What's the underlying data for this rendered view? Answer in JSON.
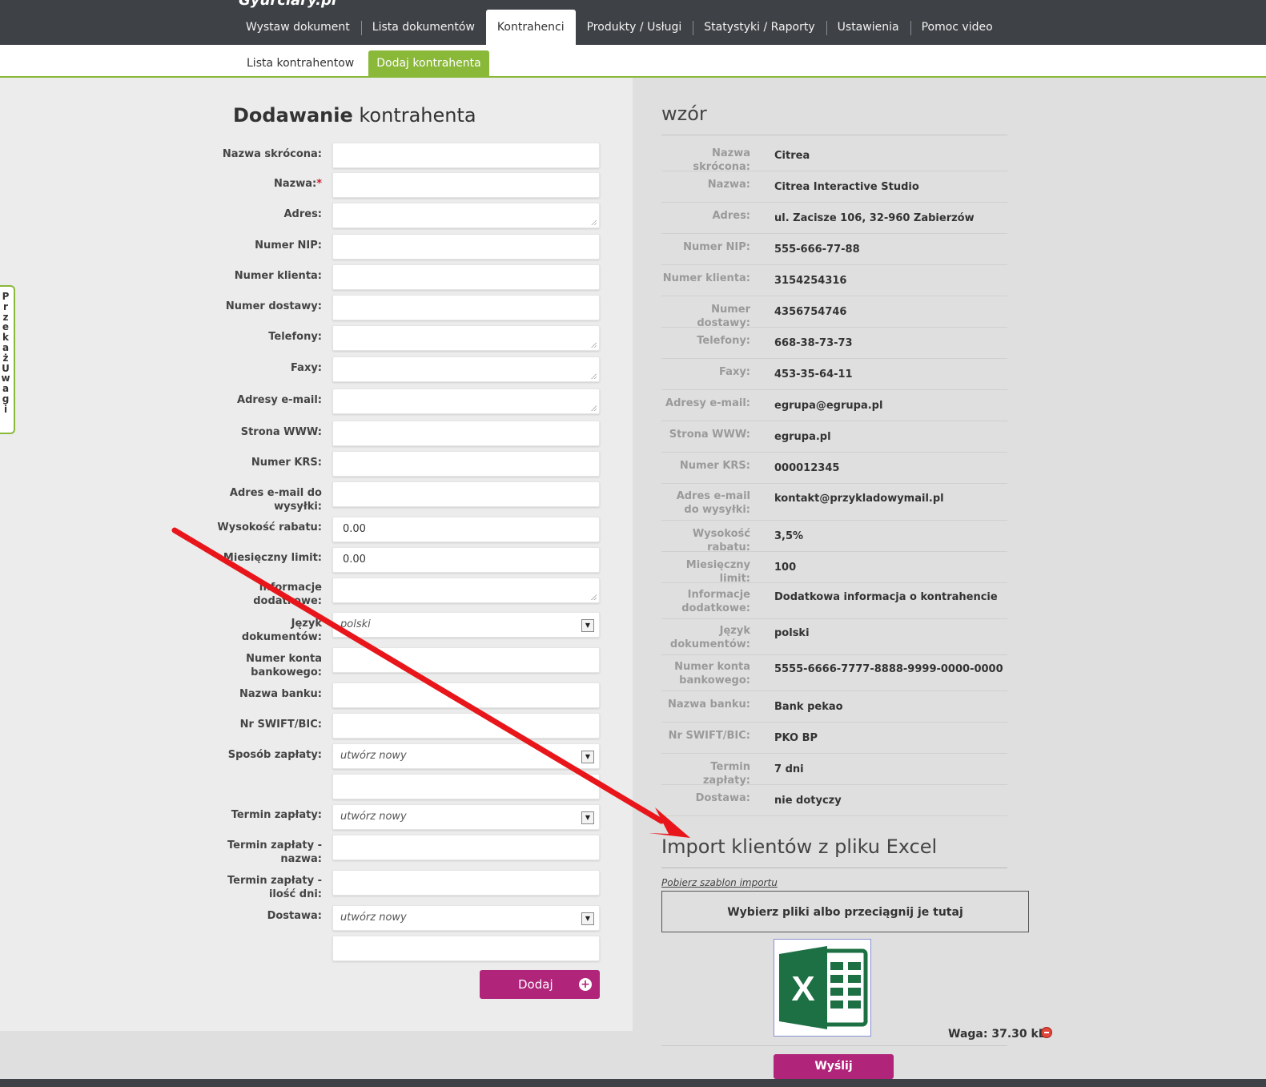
{
  "topbar": {
    "logo_fragment": "Gyurciary.pl",
    "nav": [
      "Wystaw dokument",
      "Lista dokumentów",
      "Kontrahenci",
      "Produkty / Usługi",
      "Statystyki / Raporty",
      "Ustawienia",
      "Pomoc video"
    ],
    "active_index": 2
  },
  "subnav": {
    "items": [
      "Lista kontrahentow",
      "Dodaj kontrahenta"
    ],
    "active_index": 1
  },
  "feedback_tab": "Przekaż Uwagi",
  "form": {
    "title_bold": "Dodawanie",
    "title_rest": " kontrahenta",
    "fields": {
      "nazwa_skrocona": {
        "label": "Nazwa skrócona:",
        "value": ""
      },
      "nazwa": {
        "label": "Nazwa:",
        "required": "*",
        "value": ""
      },
      "adres": {
        "label": "Adres:",
        "value": ""
      },
      "numer_nip": {
        "label": "Numer NIP:",
        "value": ""
      },
      "numer_klienta": {
        "label": "Numer klienta:",
        "value": ""
      },
      "numer_dostawy": {
        "label": "Numer dostawy:",
        "value": ""
      },
      "telefony": {
        "label": "Telefony:",
        "value": ""
      },
      "faxy": {
        "label": "Faxy:",
        "value": ""
      },
      "adresy_email": {
        "label": "Adresy e-mail:",
        "value": ""
      },
      "strona_www": {
        "label": "Strona WWW:",
        "value": ""
      },
      "numer_krs": {
        "label": "Numer KRS:",
        "value": ""
      },
      "email_wysylki": {
        "label": "Adres e-mail do wysyłki:",
        "value": ""
      },
      "rabat": {
        "label": "Wysokość rabatu:",
        "value": "0.00"
      },
      "limit": {
        "label": "Miesięczny limit:",
        "value": "0.00"
      },
      "informacje": {
        "label": "Informacje dodatkowe:",
        "value": ""
      },
      "jezyk": {
        "label": "Język dokumentów:",
        "value": "polski"
      },
      "konto": {
        "label": "Numer konta bankowego:",
        "value": ""
      },
      "bank": {
        "label": "Nazwa banku:",
        "value": ""
      },
      "swift": {
        "label": "Nr SWIFT/BIC:",
        "value": ""
      },
      "sposob_zaplaty": {
        "label": "Sposób zapłaty:",
        "value": "utwórz nowy",
        "extra_value": ""
      },
      "termin_zaplaty": {
        "label": "Termin zapłaty:",
        "value": "utwórz nowy"
      },
      "termin_nazwa": {
        "label": "Termin zapłaty - nazwa:",
        "value": ""
      },
      "termin_dni": {
        "label": "Termin zapłaty - ilość dni:",
        "value": ""
      },
      "dostawa": {
        "label": "Dostawa:",
        "value": "utwórz nowy",
        "extra_value": ""
      }
    },
    "dropdown_glyph": "▼",
    "submit_label": "Dodaj",
    "submit_icon": "+"
  },
  "sample": {
    "title": "wzór",
    "rows": [
      {
        "label": "Nazwa skrócona:",
        "value": "Citrea"
      },
      {
        "label": "Nazwa:",
        "value": "Citrea Interactive Studio"
      },
      {
        "label": "Adres:",
        "value": "ul. Zacisze 106, 32-960 Zabierzów"
      },
      {
        "label": "Numer NIP:",
        "value": "555-666-77-88"
      },
      {
        "label": "Numer klienta:",
        "value": "3154254316"
      },
      {
        "label": "Numer dostawy:",
        "value": "4356754746"
      },
      {
        "label": "Telefony:",
        "value": "668-38-73-73"
      },
      {
        "label": "Faxy:",
        "value": "453-35-64-11"
      },
      {
        "label": "Adresy e-mail:",
        "value": "egrupa@egrupa.pl"
      },
      {
        "label": "Strona WWW:",
        "value": "egrupa.pl"
      },
      {
        "label": "Numer KRS:",
        "value": "000012345"
      },
      {
        "label": "Adres e-mail do wysyłki:",
        "value": "kontakt@przykladowymail.pl"
      },
      {
        "label": "Wysokość rabatu:",
        "value": "3,5%"
      },
      {
        "label": "Miesięczny limit:",
        "value": "100"
      },
      {
        "label": "Informacje dodatkowe:",
        "value": "Dodatkowa informacja o kontrahencie"
      },
      {
        "label": "Język dokumentów:",
        "value": "polski"
      },
      {
        "label": "Numer konta bankowego:",
        "value": "5555-6666-7777-8888-9999-0000-0000"
      },
      {
        "label": "Nazwa banku:",
        "value": "Bank pekao"
      },
      {
        "label": "Nr SWIFT/BIC:",
        "value": "PKO BP"
      },
      {
        "label": "Termin zapłaty:",
        "value": "7 dni"
      },
      {
        "label": "Dostawa:",
        "value": "nie dotyczy"
      }
    ]
  },
  "import": {
    "title": "Import klientów z pliku Excel",
    "template_link": "Pobierz szablon importu",
    "dropzone": "Wybierz pliki albo przeciągnij je tutaj",
    "file_icon": "excel-icon",
    "file_icon_letter": "X",
    "file_size": "Waga: 37.30 kB",
    "send_label": "Wyślij"
  },
  "colors": {
    "topbar": "#3e4145",
    "accent_green": "#8ab839",
    "button_magenta": "#b0247a",
    "annotation_arrow": "#e8161b",
    "excel_green": "#1d7044"
  }
}
